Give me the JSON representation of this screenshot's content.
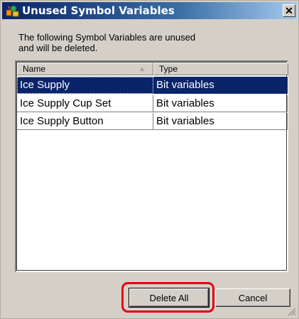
{
  "window": {
    "title": "Unused Symbol Variables",
    "close_label": "✕"
  },
  "description": {
    "line1": "The following Symbol Variables are unused",
    "line2": "and will be deleted."
  },
  "list": {
    "columns": [
      {
        "label": "Name"
      },
      {
        "label": "Type"
      }
    ],
    "sort_indicator": "▲",
    "rows": [
      {
        "name": "Ice Supply",
        "type": "Bit variables",
        "selected": true
      },
      {
        "name": "Ice Supply Cup Set",
        "type": "Bit variables",
        "selected": false
      },
      {
        "name": "Ice Supply Button",
        "type": "Bit variables",
        "selected": false
      }
    ]
  },
  "buttons": {
    "delete_all": "Delete All",
    "cancel": "Cancel"
  },
  "colors": {
    "selection": "#0a246a",
    "highlight": "#e60012",
    "dialog_bg": "#d4d0c8"
  }
}
